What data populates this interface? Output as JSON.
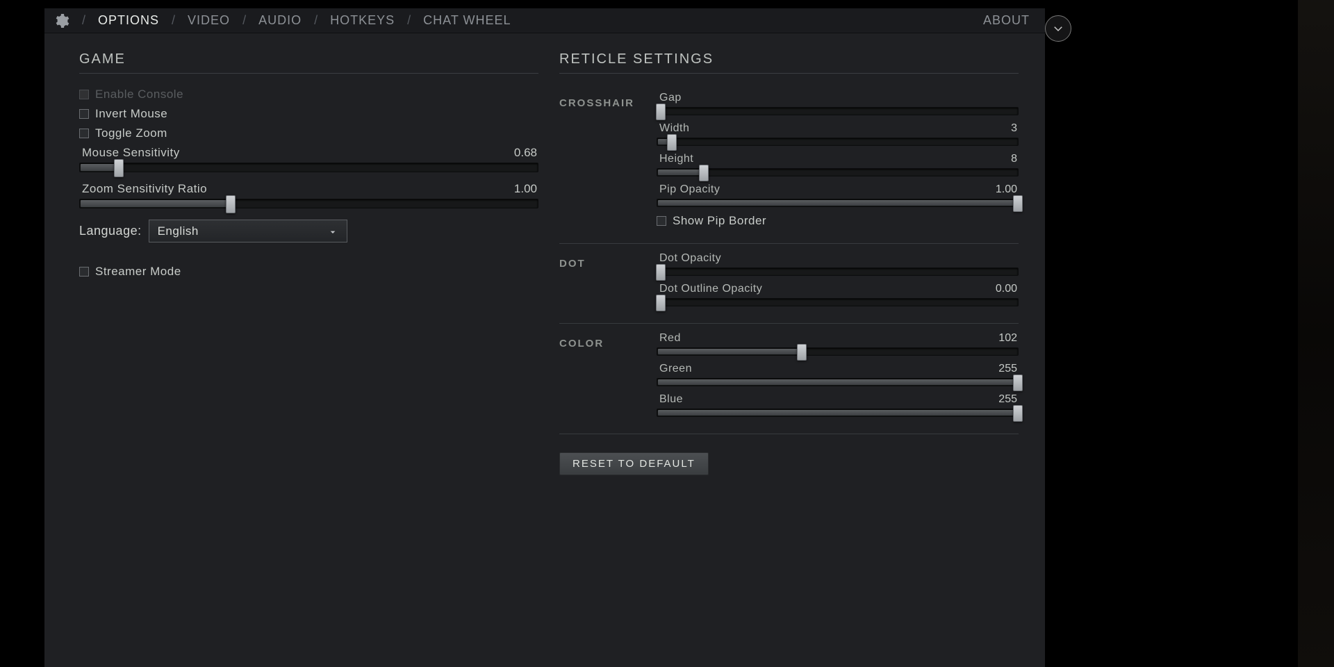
{
  "tabs": {
    "options": "OPTIONS",
    "video": "VIDEO",
    "audio": "AUDIO",
    "hotkeys": "HOTKEYS",
    "chat_wheel": "CHAT WHEEL",
    "about": "ABOUT"
  },
  "game": {
    "title": "GAME",
    "enable_console": "Enable Console",
    "invert_mouse": "Invert Mouse",
    "toggle_zoom": "Toggle Zoom",
    "mouse_sens": {
      "label": "Mouse Sensitivity",
      "value": "0.68",
      "pct": 8.5
    },
    "zoom_ratio": {
      "label": "Zoom Sensitivity Ratio",
      "value": "1.00",
      "pct": 33
    },
    "language_label": "Language:",
    "language_value": "English",
    "streamer_mode": "Streamer Mode"
  },
  "reticle": {
    "title": "RETICLE SETTINGS",
    "reset": "RESET TO DEFAULT",
    "groups": {
      "crosshair": {
        "name": "CROSSHAIR",
        "gap": {
          "label": "Gap",
          "value": "",
          "pct": 1
        },
        "width": {
          "label": "Width",
          "value": "3",
          "pct": 4
        },
        "height": {
          "label": "Height",
          "value": "8",
          "pct": 13
        },
        "pip_opacity": {
          "label": "Pip Opacity",
          "value": "1.00",
          "pct": 100
        },
        "pip_border": "Show Pip Border"
      },
      "dot": {
        "name": "DOT",
        "dot_opacity": {
          "label": "Dot Opacity",
          "value": "",
          "pct": 1
        },
        "dot_outline_opacity": {
          "label": "Dot Outline Opacity",
          "value": "0.00",
          "pct": 1
        }
      },
      "color": {
        "name": "COLOR",
        "red": {
          "label": "Red",
          "value": "102",
          "pct": 40
        },
        "green": {
          "label": "Green",
          "value": "255",
          "pct": 100
        },
        "blue": {
          "label": "Blue",
          "value": "255",
          "pct": 100
        }
      }
    }
  }
}
